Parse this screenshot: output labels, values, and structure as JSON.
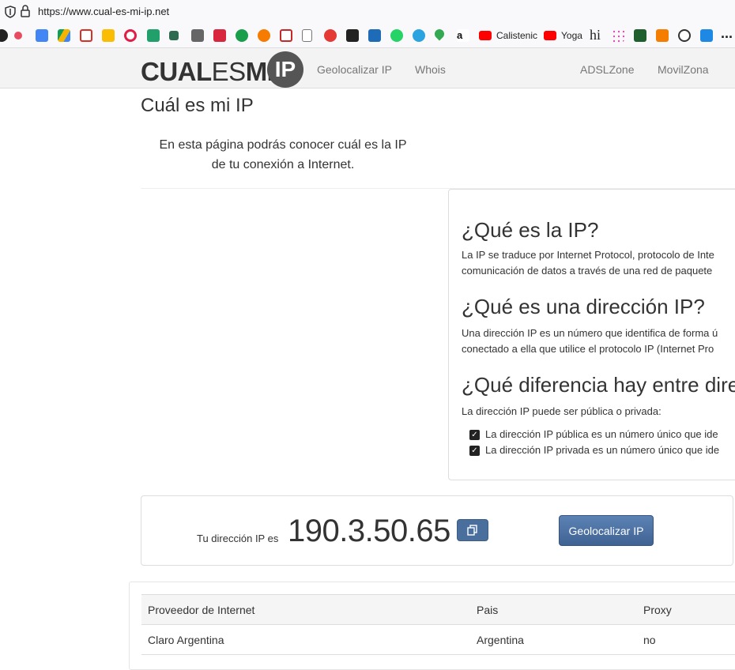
{
  "browser": {
    "url": "https://www.cual-es-mi-ip.net"
  },
  "bookmarks": {
    "items": [
      {
        "label": "Calistenic",
        "icon": "youtube-icon"
      },
      {
        "label": "Yoga",
        "icon": "youtube-icon"
      },
      {
        "label": "hi",
        "icon": "hi-icon"
      }
    ],
    "overflow": "..."
  },
  "site": {
    "logo_bold1": "CUAL",
    "logo_thin": "ES",
    "logo_bold2": "MI",
    "logo_circle": "IP",
    "nav": [
      "Geolocalizar IP",
      "Whois",
      "ADSLZone",
      "MovilZona"
    ]
  },
  "main": {
    "title": "Cuál es mi IP",
    "intro_line1": "En esta página podrás conocer cuál es la IP",
    "intro_line2": "de tu conexión a Internet."
  },
  "info": {
    "h1": "¿Qué es la IP?",
    "p1_line1": "La IP se traduce por Internet Protocol, protocolo de Inte",
    "p1_line2": "comunicación de datos a través de una red de paquete",
    "h2": "¿Qué es una dirección IP?",
    "p2_line1": "Una dirección IP es un número que identifica de forma ú",
    "p2_line2": "conectado a ella que utilice el protocolo IP (Internet Pro",
    "h3": "¿Qué diferencia hay entre dire",
    "p3": "La dirección IP puede ser pública o privada:",
    "check1": "La dirección IP pública es un número único que ide",
    "check2": "La dirección IP privada es un número único que ide"
  },
  "ip": {
    "label": "Tu dirección IP es",
    "value": "190.3.50.65",
    "geo_button": "Geolocalizar IP"
  },
  "isp_table": {
    "headers": [
      "Proveedor de Internet",
      "Pais",
      "Proxy"
    ],
    "rows": [
      [
        "Claro Argentina",
        "Argentina",
        "no"
      ]
    ]
  },
  "colors": {
    "button_blue": "#4a6f9c",
    "nav_bg": "#f3f3f3"
  }
}
